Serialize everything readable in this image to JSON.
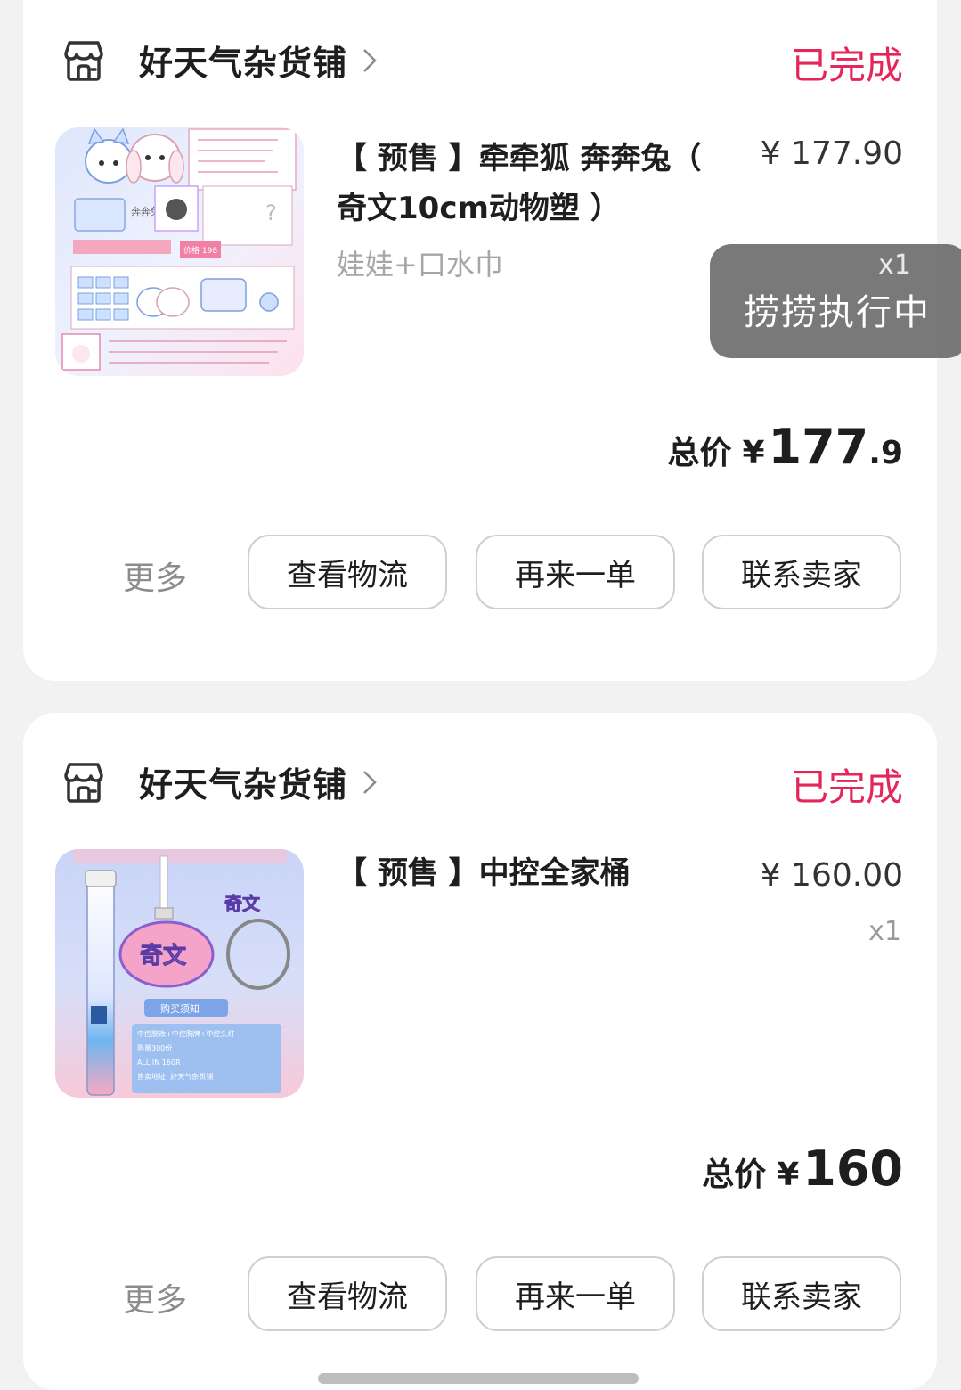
{
  "orders": [
    {
      "shop_name": "好天气杂货铺",
      "status": "已完成",
      "product_title": "【 预售 】牵牵狐 奔奔兔（ 奇文10cm动物塑 ）",
      "variant": "娃娃+口水巾",
      "unit_price": "¥ 177.90",
      "qty": "x1",
      "total_label": "总价",
      "total_yen": "¥",
      "total_int": "177",
      "total_dec": ".9",
      "more": "更多",
      "buttons": [
        "查看物流",
        "再来一单",
        "联系卖家"
      ],
      "thumb_texts": [
        "奔奔兔",
        "价格 198"
      ]
    },
    {
      "shop_name": "好天气杂货铺",
      "status": "已完成",
      "product_title": "【 预售 】中控全家桶",
      "variant": "",
      "unit_price": "¥ 160.00",
      "qty": "x1",
      "total_label": "总价",
      "total_yen": "¥",
      "total_int": "160",
      "total_dec": "",
      "more": "更多",
      "buttons": [
        "查看物流",
        "再来一单",
        "联系卖家"
      ],
      "thumb_texts": [
        "奇文",
        "购买须知",
        "中控腕改+中控胸牌+中控头灯",
        "限量300份",
        "ALL IN 160R",
        "售卖地址: 好天气杂货铺"
      ]
    }
  ],
  "toast": {
    "text": "捞捞执行中",
    "qty": "x1"
  },
  "colors": {
    "status": "#e5265a",
    "background": "#f2f2f2",
    "card": "#ffffff",
    "toast": "#6e6e6e"
  },
  "icons": [
    "shop-icon",
    "chevron-right-icon"
  ]
}
